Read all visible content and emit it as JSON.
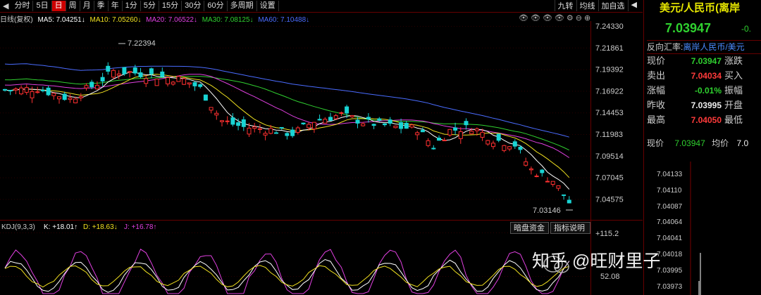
{
  "toolbar": {
    "items": [
      "分时",
      "5日",
      "日",
      "周",
      "月",
      "季",
      "年",
      "1分",
      "5分",
      "15分",
      "30分",
      "60分",
      "多周期",
      "设置"
    ],
    "active": "日",
    "right": [
      "九转",
      "均线",
      "加自选"
    ]
  },
  "indicators": {
    "prefix": "日线(复权)",
    "ma5": {
      "label": "MA5: 7.04251↓",
      "color": "#ffffff"
    },
    "ma10": {
      "label": "MA10: 7.05260↓",
      "color": "#f0e020"
    },
    "ma20": {
      "label": "MA20: 7.06522↓",
      "color": "#e040e0"
    },
    "ma30": {
      "label": "MA30: 7.08125↓",
      "color": "#30d030"
    },
    "ma60": {
      "label": "MA60: 7.10488↓",
      "color": "#4a6cff"
    }
  },
  "price_axis": [
    "7.24330",
    "7.21861",
    "7.19392",
    "7.16922",
    "7.14453",
    "7.11983",
    "7.09514",
    "7.07045",
    "7.04575"
  ],
  "annotations": {
    "high": "7.22394",
    "low": "7.03146"
  },
  "kdj": {
    "label": "KDJ(9,3,3)",
    "k": "K: +18.01↑",
    "d": "D: +18.63↓",
    "j": "J: +16.78↑",
    "buttons": [
      "暗盘资金",
      "指标说明"
    ],
    "axis_top": "+115.2",
    "axis_bottom": "52.08"
  },
  "panel": {
    "title": "美元/人民币(离岸",
    "price": "7.03947",
    "change": "-0.",
    "ref_label": "反向汇率:",
    "ref_value": "离岸人民币/美元",
    "rows": [
      {
        "label": "现价",
        "value": "7.03947",
        "cls": "green",
        "label2": "涨跌"
      },
      {
        "label": "卖出",
        "value": "7.04034",
        "cls": "red",
        "label2": "买入"
      },
      {
        "label": "涨幅",
        "value": "-0.01%",
        "cls": "green",
        "label2": "振幅"
      },
      {
        "label": "昨收",
        "value": "7.03995",
        "cls": "white",
        "label2": "开盘"
      },
      {
        "label": "最高",
        "value": "7.04050",
        "cls": "red",
        "label2": "最低"
      }
    ],
    "rt_label": "现价",
    "rt_value": "7.03947",
    "rt_avg_label": "均价",
    "rt_avg_value": "7.0",
    "rt_ticks": [
      "7.04133",
      "7.04110",
      "7.04087",
      "7.04064",
      "7.04041",
      "7.04018",
      "7.03995",
      "7.03973"
    ]
  },
  "watermark": "知乎 @旺财里子",
  "chart_data": {
    "type": "candlestick",
    "title": "",
    "ylim": [
      7.02,
      7.245
    ],
    "high_marker": 7.22394,
    "low_marker": 7.03146,
    "ma_colors": {
      "MA5": "#ffffff",
      "MA10": "#f0e020",
      "MA20": "#e040e0",
      "MA30": "#30d030",
      "MA60": "#4a6cff"
    }
  }
}
